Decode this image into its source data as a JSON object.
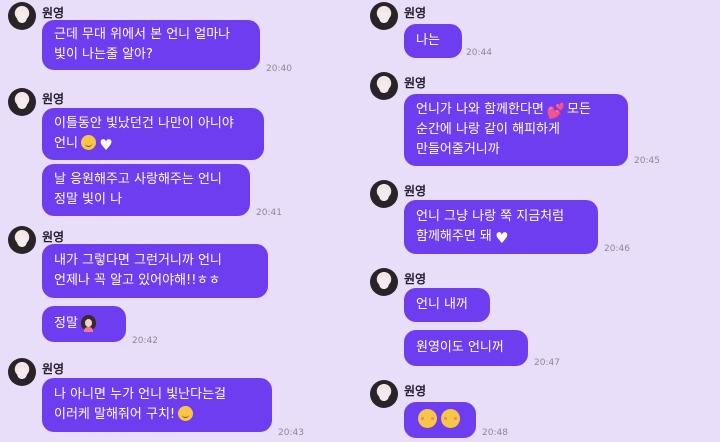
{
  "chat": {
    "sender_name": "원영",
    "left": [
      {
        "lines": [
          "근데 무대 위에서 본 언니 얼마나",
          "빛이 나는줄 알아?"
        ],
        "time": "20:40"
      },
      {
        "lines": [
          "이틀동안 빛났던건 나만이 아니야",
          "언니"
        ],
        "emoji_after": [
          "smiling-face-icon",
          "white-heart-icon"
        ]
      },
      {
        "lines": [
          "날 응원해주고 사랑해주는 언니",
          "정말 빛이 나"
        ],
        "time": "20:41"
      },
      {
        "lines": [
          "내가 그렇다면 그런거니까 언니",
          "언제나 꼭 알고 있어야해!!ㅎㅎ"
        ]
      },
      {
        "lines": [
          "정말"
        ],
        "emoji_after": [
          "girl-face-icon"
        ],
        "time": "20:42"
      },
      {
        "lines": [
          "나 아니면 누가 언니 빛난다는걸",
          "이러케 말해줘어 구치!"
        ],
        "emoji_after": [
          "blushing-face-icon"
        ],
        "time": "20:43"
      }
    ],
    "right": [
      {
        "lines": [
          "나는"
        ],
        "time": "20:44"
      },
      {
        "lines": [
          "언니가 나와 함께한다면",
          "순간에 나랑 같이 해피하게",
          "만들어줄거니까"
        ],
        "line1_after": "모든",
        "emoji_after": [
          "two-hearts-icon"
        ],
        "time": "20:45"
      },
      {
        "lines": [
          "언니 그냥 나랑 쭉 지금처럼",
          "함께해주면 돼"
        ],
        "emoji_after": [
          "white-heart-icon"
        ],
        "time": "20:46"
      },
      {
        "lines": [
          "언니 내꺼"
        ]
      },
      {
        "lines": [
          "원영이도 언니꺼"
        ],
        "time": "20:47"
      },
      {
        "lines": [
          ""
        ],
        "emoji_after": [
          "kissing-face-icon",
          "kissing-face-icon"
        ],
        "time": "20:48"
      }
    ]
  },
  "colors": {
    "background": "#e9defa",
    "bubble": "#6f3df0",
    "bubble_text": "#ffffff",
    "time_text": "#8e8796"
  }
}
